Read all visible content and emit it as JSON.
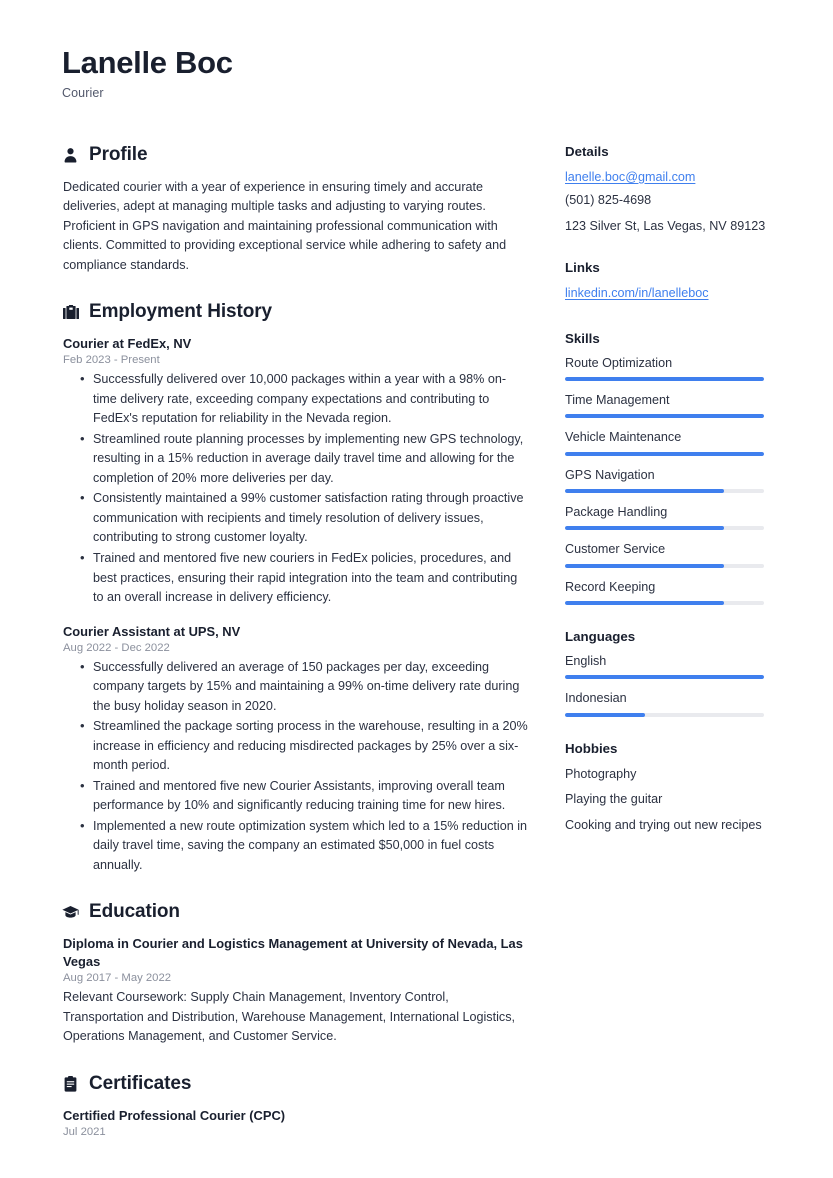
{
  "header": {
    "name": "Lanelle Boc",
    "title": "Courier"
  },
  "main": {
    "profile": {
      "heading": "Profile",
      "icon": "person-icon",
      "text": "Dedicated courier with a year of experience in ensuring timely and accurate deliveries, adept at managing multiple tasks and adjusting to varying routes. Proficient in GPS navigation and maintaining professional communication with clients. Committed to providing exceptional service while adhering to safety and compliance standards."
    },
    "employment": {
      "heading": "Employment History",
      "icon": "briefcase-icon",
      "entries": [
        {
          "title": "Courier at FedEx, NV",
          "date": "Feb 2023 - Present",
          "bullets": [
            "Successfully delivered over 10,000 packages within a year with a 98% on-time delivery rate, exceeding company expectations and contributing to FedEx's reputation for reliability in the Nevada region.",
            "Streamlined route planning processes by implementing new GPS technology, resulting in a 15% reduction in average daily travel time and allowing for the completion of 20% more deliveries per day.",
            "Consistently maintained a 99% customer satisfaction rating through proactive communication with recipients and timely resolution of delivery issues, contributing to strong customer loyalty.",
            "Trained and mentored five new couriers in FedEx policies, procedures, and best practices, ensuring their rapid integration into the team and contributing to an overall increase in delivery efficiency."
          ]
        },
        {
          "title": "Courier Assistant at UPS, NV",
          "date": "Aug 2022 - Dec 2022",
          "bullets": [
            "Successfully delivered an average of 150 packages per day, exceeding company targets by 15% and maintaining a 99% on-time delivery rate during the busy holiday season in 2020.",
            "Streamlined the package sorting process in the warehouse, resulting in a 20% increase in efficiency and reducing misdirected packages by 25% over a six-month period.",
            "Trained and mentored five new Courier Assistants, improving overall team performance by 10% and significantly reducing training time for new hires.",
            "Implemented a new route optimization system which led to a 15% reduction in daily travel time, saving the company an estimated $50,000 in fuel costs annually."
          ]
        }
      ]
    },
    "education": {
      "heading": "Education",
      "icon": "graduation-cap-icon",
      "entries": [
        {
          "title": "Diploma in Courier and Logistics Management at University of Nevada, Las Vegas",
          "date": "Aug 2017 - May 2022",
          "description": "Relevant Coursework: Supply Chain Management, Inventory Control, Transportation and Distribution, Warehouse Management, International Logistics, Operations Management, and Customer Service."
        }
      ]
    },
    "certificates": {
      "heading": "Certificates",
      "icon": "certificate-icon",
      "entries": [
        {
          "title": "Certified Professional Courier (CPC)",
          "date": "Jul 2021"
        }
      ]
    }
  },
  "sidebar": {
    "details": {
      "heading": "Details",
      "email": "lanelle.boc@gmail.com",
      "phone": "(501) 825-4698",
      "address": "123 Silver St, Las Vegas, NV 89123"
    },
    "links": {
      "heading": "Links",
      "items": [
        {
          "label": "linkedin.com/in/lanelleboc"
        }
      ]
    },
    "skills": {
      "heading": "Skills",
      "items": [
        {
          "label": "Route Optimization",
          "level": 100
        },
        {
          "label": "Time Management",
          "level": 100
        },
        {
          "label": "Vehicle Maintenance",
          "level": 100
        },
        {
          "label": "GPS Navigation",
          "level": 80
        },
        {
          "label": "Package Handling",
          "level": 80
        },
        {
          "label": "Customer Service",
          "level": 80
        },
        {
          "label": "Record Keeping",
          "level": 80
        }
      ]
    },
    "languages": {
      "heading": "Languages",
      "items": [
        {
          "label": "English",
          "level": 100
        },
        {
          "label": "Indonesian",
          "level": 40
        }
      ]
    },
    "hobbies": {
      "heading": "Hobbies",
      "items": [
        {
          "label": "Photography"
        },
        {
          "label": "Playing the guitar"
        },
        {
          "label": "Cooking and trying out new recipes"
        }
      ]
    }
  },
  "theme": {
    "accent": "#3f7fee",
    "text": "#2b3141",
    "heading": "#191f2e",
    "muted": "#8b909d",
    "track": "#e9eaee"
  }
}
